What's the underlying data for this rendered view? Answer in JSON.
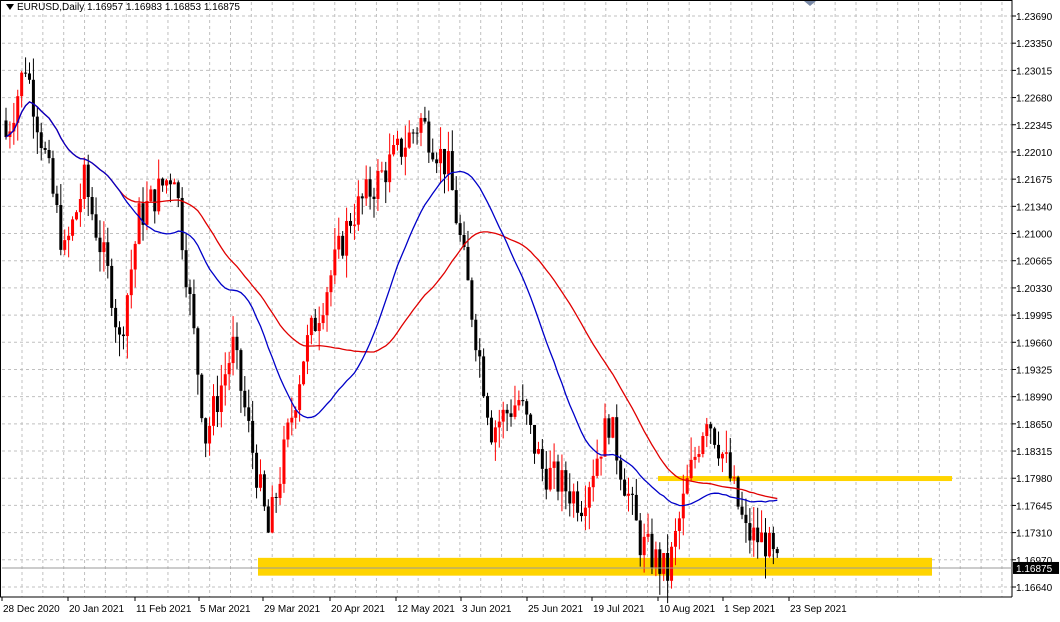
{
  "header": {
    "symbol": "EURUSD,Daily",
    "open": "1.16957",
    "high": "1.16983",
    "low": "1.16853",
    "close": "1.16875"
  },
  "colors": {
    "bull": "#ff0000",
    "bear": "#000000",
    "ma_fast": "#0000c8",
    "ma_slow": "#e00000",
    "zone": "#ffd400",
    "grid": "#c0c0c0",
    "price_tag_bg": "#000000",
    "price_tag_fg": "#ffffff"
  },
  "chart_data": {
    "type": "candlestick",
    "title": "EURUSD,Daily",
    "grid": true,
    "y_ticks": [
      "1.23690",
      "1.23350",
      "1.23015",
      "1.22680",
      "1.22345",
      "1.22010",
      "1.21675",
      "1.21340",
      "1.21000",
      "1.20665",
      "1.20330",
      "1.19995",
      "1.19660",
      "1.19325",
      "1.18990",
      "1.18650",
      "1.18315",
      "1.17980",
      "1.17645",
      "1.17310",
      "1.16970",
      "1.16640"
    ],
    "ylim": [
      1.165,
      1.2382
    ],
    "x_tick_labels": [
      "28 Dec 2020",
      "20 Jan 2021",
      "11 Feb 2021",
      "5 Mar 2021",
      "29 Mar 2021",
      "20 Apr 2021",
      "12 May 2021",
      "3 Jun 2021",
      "25 Jun 2021",
      "19 Jul 2021",
      "10 Aug 2021",
      "1 Sep 2021",
      "23 Sep 2021"
    ],
    "current_price": "1.16875",
    "support_zones": [
      {
        "from": 1.17,
        "to": 1.1678,
        "start_label": "29 Mar 2021"
      },
      {
        "from": 1.1801,
        "to": 1.1796,
        "start_label": "10 Aug 2021"
      }
    ],
    "close_path_keypoints": [
      {
        "date": "28 Dec 2020",
        "close": 1.222
      },
      {
        "date": "4 Jan 2021",
        "close": 1.231
      },
      {
        "date": "8 Jan 2021",
        "close": 1.222
      },
      {
        "date": "18 Jan 2021",
        "close": 1.2075
      },
      {
        "date": "25 Jan 2021",
        "close": 1.2165
      },
      {
        "date": "3 Feb 2021",
        "close": 1.203
      },
      {
        "date": "5 Feb 2021",
        "close": 1.1965
      },
      {
        "date": "12 Feb 2021",
        "close": 1.212
      },
      {
        "date": "25 Feb 2021",
        "close": 1.218
      },
      {
        "date": "9 Mar 2021",
        "close": 1.185
      },
      {
        "date": "18 Mar 2021",
        "close": 1.196
      },
      {
        "date": "31 Mar 2021",
        "close": 1.173
      },
      {
        "date": "13 Apr 2021",
        "close": 1.195
      },
      {
        "date": "29 Apr 2021",
        "close": 1.212
      },
      {
        "date": "7 May 2021",
        "close": 1.216
      },
      {
        "date": "25 May 2021",
        "close": 1.224
      },
      {
        "date": "3 Jun 2021",
        "close": 1.218
      },
      {
        "date": "18 Jun 2021",
        "close": 1.186
      },
      {
        "date": "29 Jun 2021",
        "close": 1.1895
      },
      {
        "date": "7 Jul 2021",
        "close": 1.181
      },
      {
        "date": "21 Jul 2021",
        "close": 1.177
      },
      {
        "date": "30 Jul 2021",
        "close": 1.187
      },
      {
        "date": "11 Aug 2021",
        "close": 1.172
      },
      {
        "date": "20 Aug 2021",
        "close": 1.168
      },
      {
        "date": "27 Aug 2021",
        "close": 1.179
      },
      {
        "date": "3 Sep 2021",
        "close": 1.188
      },
      {
        "date": "10 Sep 2021",
        "close": 1.1815
      },
      {
        "date": "17 Sep 2021",
        "close": 1.173
      },
      {
        "date": "24 Sep 2021",
        "close": 1.172
      },
      {
        "date": "29 Sep 2021",
        "close": 1.1687
      }
    ]
  }
}
